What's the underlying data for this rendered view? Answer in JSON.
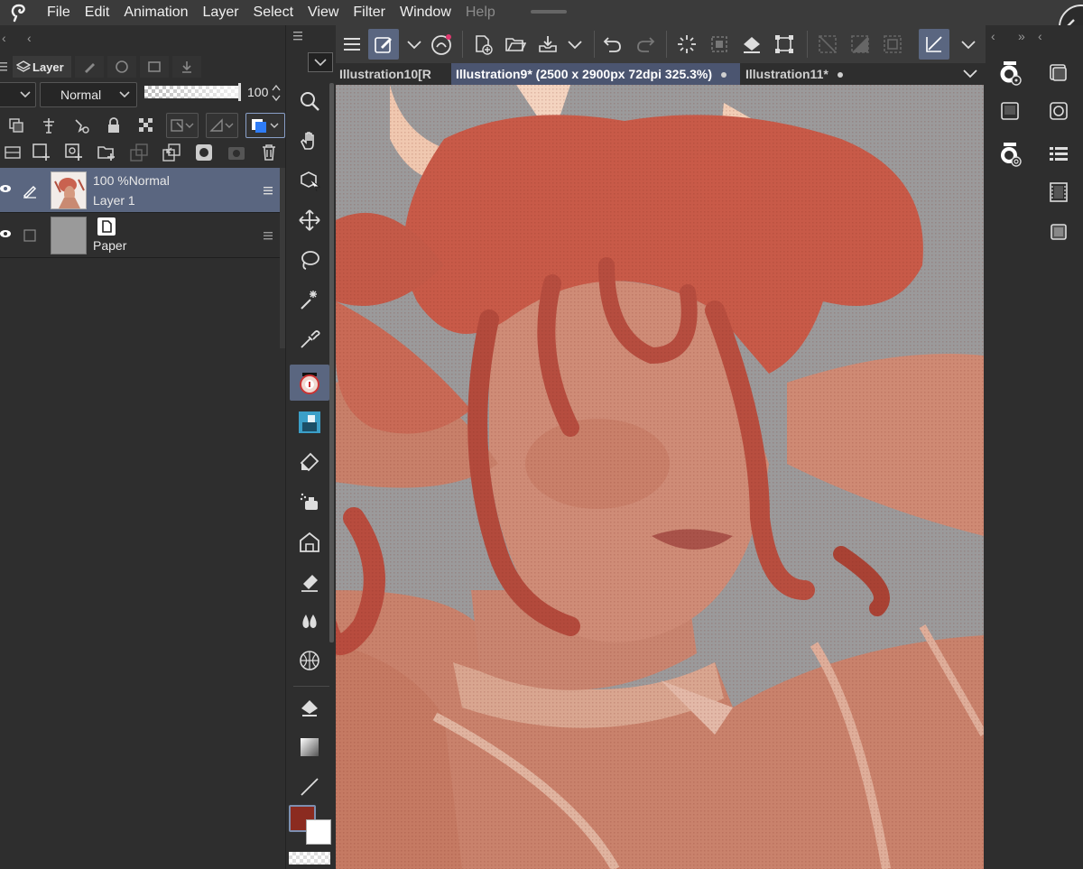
{
  "menu": {
    "items": [
      "File",
      "Edit",
      "Animation",
      "Layer",
      "Select",
      "View",
      "Filter",
      "Window",
      "Help"
    ]
  },
  "layer_panel": {
    "tab_label": "Layer",
    "blend_mode": "Normal",
    "opacity_value": "100",
    "layers": [
      {
        "line1": "100 %Normal",
        "line2": "Layer 1",
        "visible": true,
        "selected": true
      },
      {
        "line1": "",
        "line2": "Paper",
        "visible": true,
        "selected": false
      }
    ]
  },
  "document_tabs": [
    {
      "label": "Illustration10[R",
      "active": false
    },
    {
      "label": "Illustration9* (2500 x 2900px 72dpi 325.3%)",
      "active": true
    },
    {
      "label": "Illustration11*",
      "active": false
    }
  ],
  "colors": {
    "main_color": "#8b2b20",
    "sub_color": "#ffffff",
    "selection_accent": "#5a6680",
    "canvas_background": "#9b9a9b"
  },
  "tools": [
    "zoom-icon",
    "hand-icon",
    "object-select-icon",
    "move-icon",
    "lasso-icon",
    "magic-wand-icon",
    "eyedropper-icon",
    "pen-icon",
    "pencil-icon",
    "brush-icon",
    "airbrush-icon",
    "decoration-icon",
    "eraser-icon",
    "blend-icon",
    "figure-icon",
    "fill-icon",
    "gradient-icon",
    "line-icon"
  ]
}
